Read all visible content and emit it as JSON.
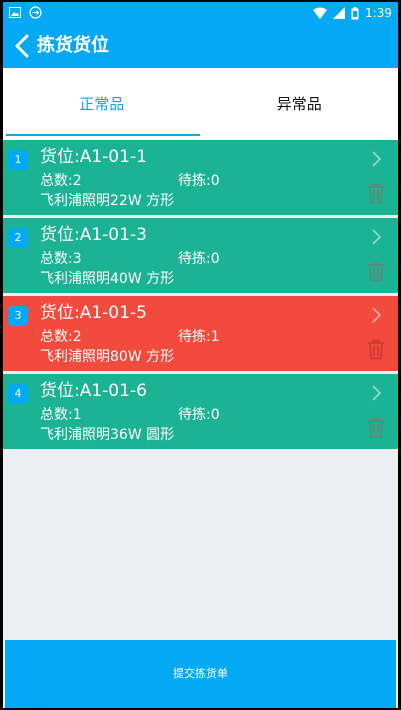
{
  "status_bar": {
    "time": "1:39"
  },
  "app_bar": {
    "title": "拣货货位"
  },
  "tabs": [
    {
      "label": "正常品",
      "active": true
    },
    {
      "label": "异常品",
      "active": false
    }
  ],
  "colors": {
    "accent": "#03a9f4",
    "normal_row": "#1ab394",
    "highlight_row": "#f24a3d"
  },
  "items": [
    {
      "index": "1",
      "location": "货位:A1-01-1",
      "total": "总数:2",
      "pending": "待拣:0",
      "product": "飞利浦照明22W 方形",
      "state": "normal"
    },
    {
      "index": "2",
      "location": "货位:A1-01-3",
      "total": "总数:3",
      "pending": "待拣:0",
      "product": "飞利浦照明40W 方形",
      "state": "normal"
    },
    {
      "index": "3",
      "location": "货位:A1-01-5",
      "total": "总数:2",
      "pending": "待拣:1",
      "product": "飞利浦照明80W 方形",
      "state": "highlight"
    },
    {
      "index": "4",
      "location": "货位:A1-01-6",
      "total": "总数:1",
      "pending": "待拣:0",
      "product": "飞利浦照明36W 圆形",
      "state": "normal"
    }
  ],
  "submit": {
    "label": "提交拣货单"
  }
}
